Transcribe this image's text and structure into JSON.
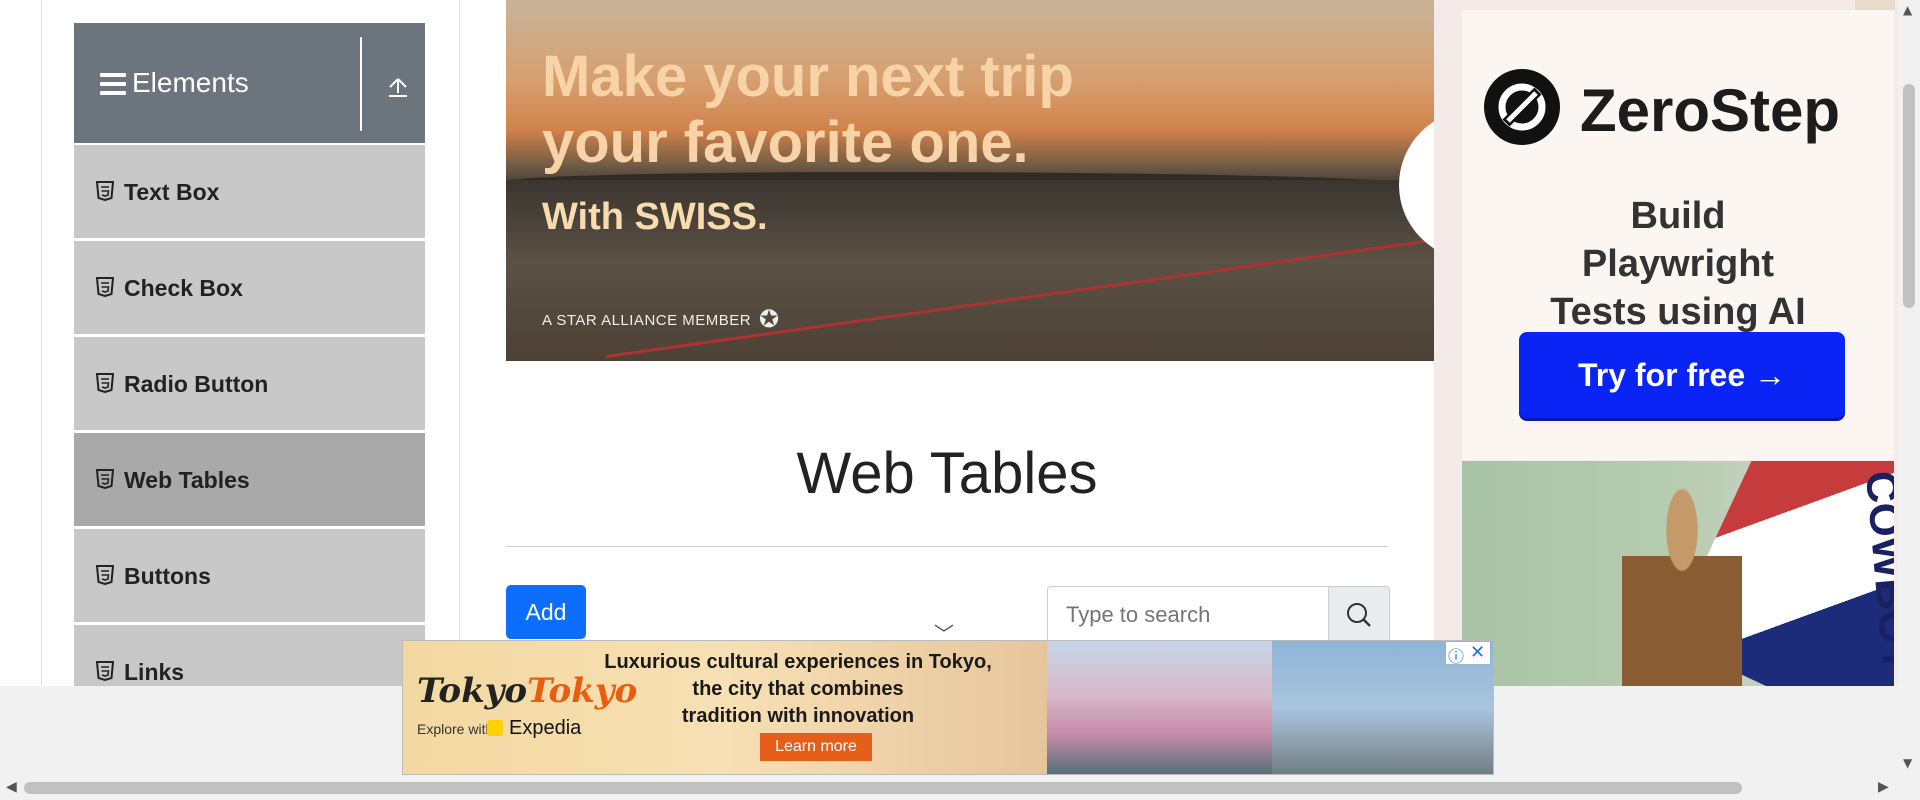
{
  "sidebar": {
    "group_title": "Elements",
    "items": [
      {
        "label": "Text Box",
        "active": false
      },
      {
        "label": "Check Box",
        "active": false
      },
      {
        "label": "Radio Button",
        "active": false
      },
      {
        "label": "Web Tables",
        "active": true
      },
      {
        "label": "Buttons",
        "active": false
      },
      {
        "label": "Links",
        "active": false
      }
    ]
  },
  "banner_ad": {
    "headline": "Make your next trip your favorite one.",
    "subline": "With SWISS.",
    "footnote": "A STAR ALLIANCE MEMBER"
  },
  "main": {
    "title": "Web Tables",
    "add_label": "Add",
    "search_placeholder": "Type to search"
  },
  "right_ad": {
    "brand": "ZeroStep",
    "tagline": "Build Playwright Tests using AI",
    "cta": "Try for free →",
    "cta_color": "#0a24f5"
  },
  "photo_ad": {
    "sash_text": "COWBOY"
  },
  "bottom_ad": {
    "logo_a": "Tokyo",
    "logo_b": "Tokyo",
    "explore": "Explore with",
    "partner": "Expedia",
    "copy_line1": "Luxurious cultural experiences in Tokyo,",
    "copy_line2": "the city that combines",
    "copy_line3": "tradition with innovation",
    "cta": "Learn more"
  },
  "colors": {
    "sidebar_header": "#6c757d",
    "menu_item": "#c8c8c8",
    "menu_item_active": "#a9a9a9",
    "add_button": "#0d6efd"
  }
}
